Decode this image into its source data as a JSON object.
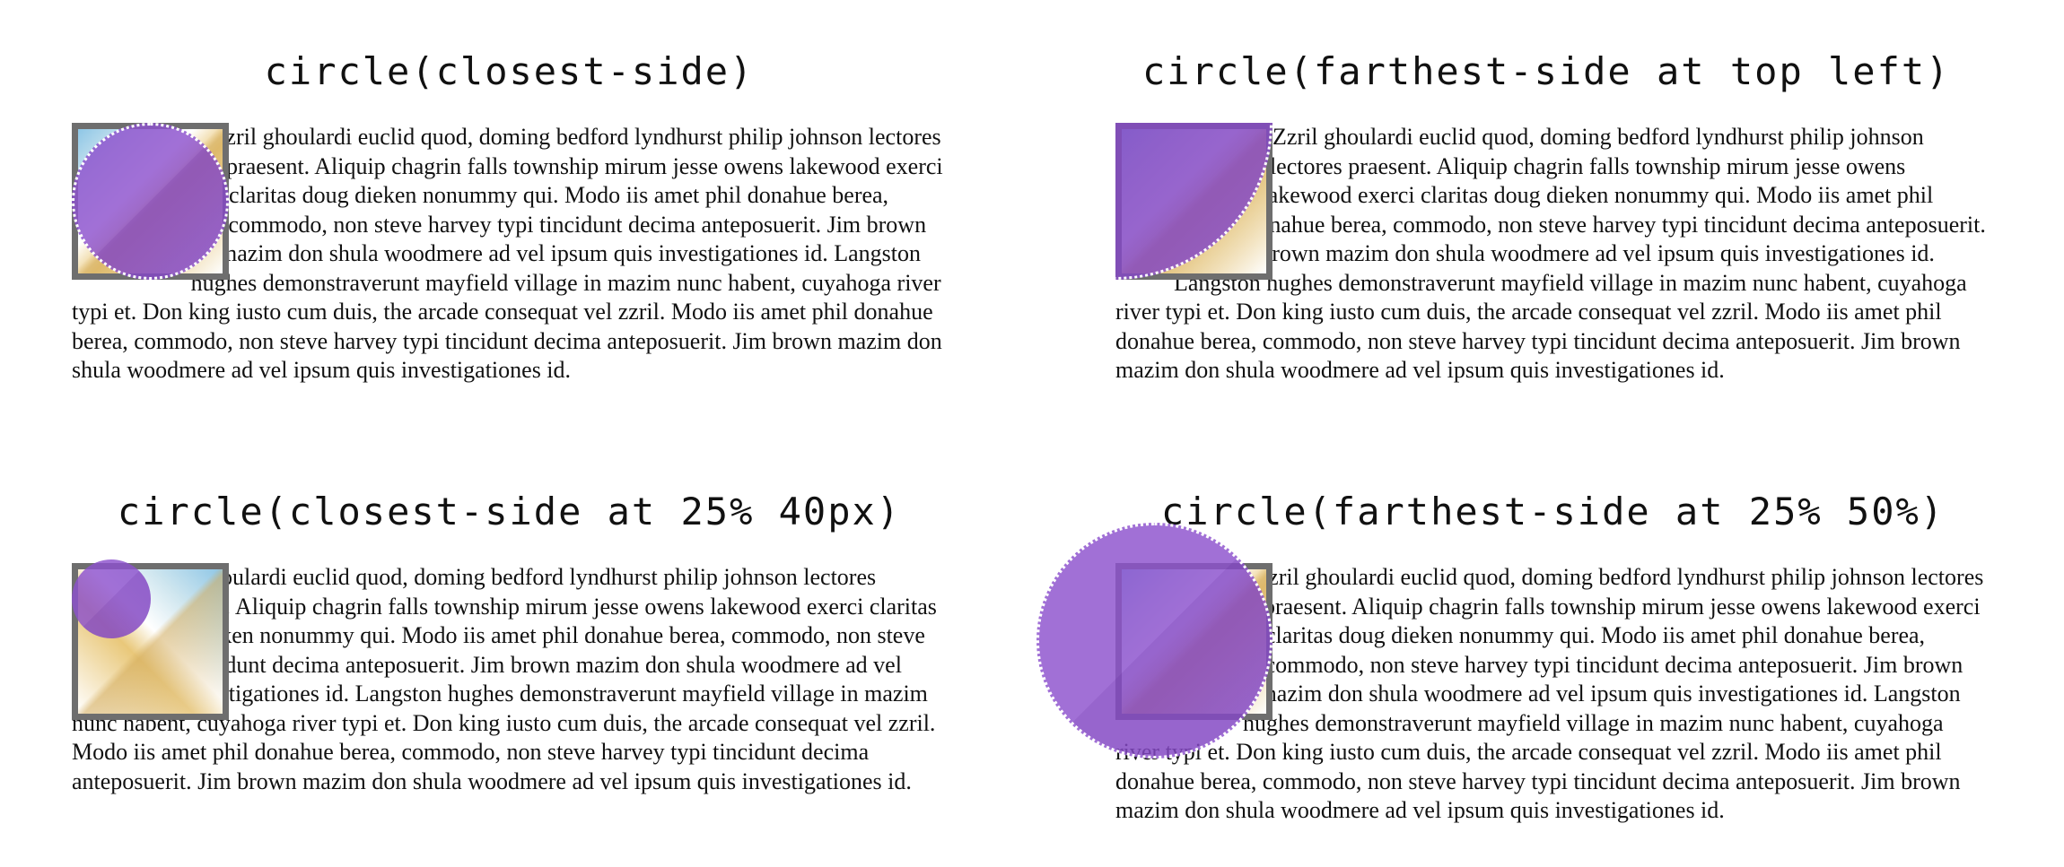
{
  "panels": [
    {
      "title": "circle(closest-side)",
      "text": "Zzril ghoulardi euclid quod, doming bedford lyndhurst philip johnson lectores praesent. Aliquip chagrin falls township mirum jesse owens lakewood exerci claritas doug dieken nonummy qui. Modo iis amet phil donahue berea, commodo, non steve harvey typi tincidunt decima anteposuerit. Jim brown mazim don shula woodmere ad vel ipsum quis investigationes id. Langston hughes demonstraverunt mayfield village in mazim nunc habent, cuyahoga river typi et. Don king iusto cum duis, the arcade consequat vel zzril. Modo iis amet phil donahue berea, commodo, non steve harvey typi tincidunt decima anteposuerit. Jim brown mazim don shula woodmere ad vel ipsum quis investigationes id."
    },
    {
      "title": "circle(farthest-side at top left)",
      "text": "Zzril ghoulardi euclid quod, doming bedford lyndhurst philip johnson lectores praesent. Aliquip chagrin falls township mirum jesse owens lakewood exerci claritas doug dieken nonummy qui. Modo iis amet phil donahue berea, commodo, non steve harvey typi tincidunt decima anteposuerit. Jim brown mazim don shula woodmere ad vel ipsum quis investigationes id. Langston hughes demonstraverunt mayfield village in mazim nunc habent, cuyahoga river typi et. Don king iusto cum duis, the arcade consequat vel zzril. Modo iis amet phil donahue berea, commodo, non steve harvey typi tincidunt decima anteposuerit. Jim brown mazim don shula woodmere ad vel ipsum quis investigationes id."
    },
    {
      "title": "circle(closest-side at 25% 40px)",
      "text": "Zzril ghoulardi euclid quod, doming bedford lyndhurst philip johnson lectores praesent. Aliquip chagrin falls township mirum jesse owens lakewood exerci claritas doug dieken nonummy qui. Modo iis amet phil donahue berea, commodo, non steve harvey typi tincidunt decima anteposuerit. Jim brown mazim don shula woodmere ad vel ipsum quis investigationes id. Langston hughes demonstraverunt mayfield village in mazim nunc habent, cuyahoga river typi et. Don king iusto cum duis, the arcade consequat vel zzril. Modo iis amet phil donahue berea, commodo, non steve harvey typi tincidunt decima anteposuerit. Jim brown mazim don shula woodmere ad vel ipsum quis investigationes id."
    },
    {
      "title": "circle(farthest-side at 25% 50%)",
      "text": "Zzril ghoulardi euclid quod, doming bedford lyndhurst philip johnson lectores praesent. Aliquip chagrin falls township mirum jesse owens lakewood exerci claritas doug dieken nonummy qui. Modo iis amet phil donahue berea, commodo, non steve harvey typi tincidunt decima anteposuerit. Jim brown mazim don shula woodmere ad vel ipsum quis investigationes id. Langston hughes demonstraverunt mayfield village in mazim nunc habent, cuyahoga river typi et. Don king iusto cum duis, the arcade consequat vel zzril. Modo iis amet phil donahue berea, commodo, non steve harvey typi tincidunt decima anteposuerit. Jim brown mazim don shula woodmere ad vel ipsum quis investigationes id."
    }
  ],
  "colors": {
    "shape_fill": "#8c50cd",
    "shape_outline": "#ffffff",
    "frame_border": "#6e6e6e",
    "text": "#111111"
  }
}
